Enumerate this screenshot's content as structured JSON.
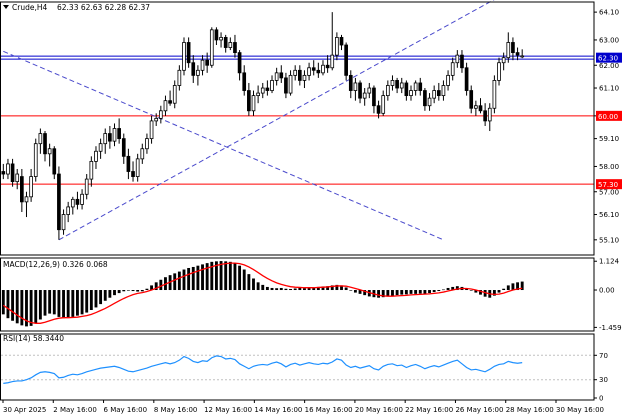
{
  "window": {
    "symbol_title": "Crude,H4",
    "ohlc": "62.33 62.63 62.28 62.37"
  },
  "colors": {
    "bull": "#ffffff",
    "bear": "#000000",
    "level": "#ff0000",
    "blue_level": "#0000cc",
    "trend": "#4a4acc",
    "macd_signal": "#ff0000",
    "rsi": "#1e90ff",
    "grid": "#c0c0c0"
  },
  "chart_data": [
    {
      "type": "candlestick",
      "title": "Crude,H4",
      "ylim": [
        54.5,
        64.5
      ],
      "yticks": [
        "64.10",
        "63.00",
        "62.00",
        "61.10",
        "60.00",
        "59.10",
        "58.00",
        "57.00",
        "56.10",
        "55.10"
      ],
      "xticks": [
        "30 Apr 2025",
        "2 May 16:00",
        "6 May 16:00",
        "8 May 16:00",
        "12 May 16:00",
        "14 May 16:00",
        "16 May 16:00",
        "20 May 16:00",
        "22 May 16:00",
        "26 May 16:00",
        "28 May 16:00",
        "30 May 16:00"
      ],
      "levels": [
        {
          "label": "62.30",
          "value": 62.3,
          "color": "blue"
        },
        {
          "label": "60.00",
          "value": 60.0,
          "color": "red"
        },
        {
          "label": "57.30",
          "value": 57.3,
          "color": "red"
        }
      ],
      "trendlines": [
        {
          "from_x": 0,
          "from_y": 62.55,
          "to_x": 95,
          "to_y": 55.1
        },
        {
          "from_x": 12,
          "from_y": 55.1,
          "to_x": 106,
          "to_y": 64.6
        }
      ],
      "x_count": 128,
      "candles": [
        [
          0,
          57.8,
          58.1,
          57.5,
          57.7
        ],
        [
          1,
          57.7,
          58.3,
          57.5,
          58.1
        ],
        [
          2,
          58.1,
          58.3,
          57.2,
          57.4
        ],
        [
          3,
          57.4,
          57.9,
          57.1,
          57.7
        ],
        [
          4,
          57.6,
          57.9,
          56.2,
          56.6
        ],
        [
          5,
          56.6,
          57.0,
          56.0,
          56.8
        ],
        [
          6,
          56.8,
          57.9,
          56.6,
          57.6
        ],
        [
          7,
          57.6,
          59.1,
          57.4,
          58.9
        ],
        [
          8,
          58.9,
          59.5,
          58.5,
          59.3
        ],
        [
          9,
          59.3,
          59.4,
          58.2,
          58.5
        ],
        [
          10,
          58.5,
          58.9,
          58.0,
          58.7
        ],
        [
          11,
          58.7,
          58.8,
          57.5,
          57.7
        ],
        [
          12,
          57.7,
          58.0,
          55.1,
          55.5
        ],
        [
          13,
          55.5,
          56.3,
          55.3,
          56.1
        ],
        [
          14,
          56.1,
          56.6,
          55.8,
          56.4
        ],
        [
          15,
          56.4,
          56.8,
          56.1,
          56.7
        ],
        [
          16,
          56.7,
          57.0,
          56.3,
          56.5
        ],
        [
          17,
          56.5,
          57.1,
          56.3,
          56.9
        ],
        [
          18,
          56.9,
          57.7,
          56.7,
          57.5
        ],
        [
          19,
          57.5,
          58.4,
          57.2,
          58.2
        ],
        [
          20,
          58.2,
          58.8,
          57.9,
          58.6
        ],
        [
          21,
          58.6,
          59.1,
          58.3,
          58.9
        ],
        [
          22,
          58.9,
          59.5,
          58.5,
          59.3
        ],
        [
          23,
          59.3,
          59.6,
          58.7,
          59.0
        ],
        [
          24,
          59.0,
          59.7,
          58.8,
          59.5
        ],
        [
          25,
          59.5,
          59.9,
          58.9,
          59.1
        ],
        [
          26,
          59.1,
          59.3,
          58.1,
          58.4
        ],
        [
          27,
          58.4,
          58.7,
          57.5,
          57.8
        ],
        [
          28,
          57.8,
          58.2,
          57.4,
          57.6
        ],
        [
          29,
          57.6,
          58.5,
          57.4,
          58.3
        ],
        [
          30,
          58.3,
          58.9,
          58.1,
          58.7
        ],
        [
          31,
          58.7,
          59.3,
          58.5,
          59.1
        ],
        [
          32,
          59.1,
          60.0,
          58.9,
          59.8
        ],
        [
          33,
          59.8,
          60.1,
          59.6,
          59.9
        ],
        [
          34,
          59.9,
          60.4,
          59.7,
          60.2
        ],
        [
          35,
          60.2,
          60.8,
          60.0,
          60.6
        ],
        [
          36,
          60.6,
          61.0,
          60.4,
          60.5
        ],
        [
          37,
          60.5,
          61.4,
          60.3,
          61.2
        ],
        [
          38,
          61.2,
          62.0,
          61.0,
          61.8
        ],
        [
          39,
          61.8,
          63.1,
          61.6,
          62.9
        ],
        [
          40,
          62.9,
          63.1,
          61.9,
          62.1
        ],
        [
          41,
          62.1,
          62.4,
          61.3,
          61.6
        ],
        [
          42,
          61.6,
          62.0,
          61.2,
          61.8
        ],
        [
          43,
          61.8,
          62.4,
          61.6,
          62.2
        ],
        [
          44,
          62.2,
          62.5,
          61.7,
          62.0
        ],
        [
          45,
          62.0,
          63.5,
          61.9,
          63.4
        ],
        [
          46,
          63.4,
          63.5,
          62.8,
          63.0
        ],
        [
          47,
          63.0,
          63.3,
          62.7,
          63.1
        ],
        [
          48,
          63.1,
          63.2,
          62.5,
          62.7
        ],
        [
          49,
          62.7,
          63.1,
          62.6,
          62.9
        ],
        [
          50,
          62.9,
          63.2,
          62.3,
          62.5
        ],
        [
          51,
          62.5,
          62.6,
          61.4,
          61.7
        ],
        [
          52,
          61.7,
          62.0,
          60.8,
          61.0
        ],
        [
          53,
          61.0,
          61.3,
          60.0,
          60.2
        ],
        [
          54,
          60.2,
          61.0,
          60.0,
          60.8
        ],
        [
          55,
          60.8,
          61.2,
          60.5,
          60.9
        ],
        [
          56,
          60.9,
          61.3,
          60.7,
          61.1
        ],
        [
          57,
          61.1,
          61.4,
          60.8,
          61.0
        ],
        [
          58,
          61.0,
          61.6,
          60.9,
          61.4
        ],
        [
          59,
          61.4,
          61.9,
          61.2,
          61.7
        ],
        [
          60,
          61.7,
          62.0,
          61.3,
          61.5
        ],
        [
          61,
          61.5,
          61.7,
          60.7,
          60.9
        ],
        [
          62,
          60.9,
          61.8,
          60.8,
          61.6
        ],
        [
          63,
          61.6,
          62.0,
          61.4,
          61.8
        ],
        [
          64,
          61.8,
          62.0,
          61.2,
          61.4
        ],
        [
          65,
          61.4,
          61.8,
          61.1,
          61.6
        ],
        [
          66,
          61.6,
          62.1,
          61.4,
          61.9
        ],
        [
          67,
          61.9,
          62.2,
          61.6,
          61.8
        ],
        [
          68,
          61.8,
          62.1,
          61.5,
          61.7
        ],
        [
          69,
          61.7,
          62.2,
          61.6,
          62.0
        ],
        [
          70,
          62.0,
          62.4,
          61.7,
          61.9
        ],
        [
          71,
          61.9,
          64.1,
          61.8,
          62.4
        ],
        [
          72,
          62.4,
          63.3,
          62.2,
          63.1
        ],
        [
          73,
          63.1,
          63.2,
          62.6,
          62.8
        ],
        [
          74,
          62.8,
          62.9,
          61.4,
          61.6
        ],
        [
          75,
          61.6,
          61.8,
          60.7,
          61.0
        ],
        [
          76,
          61.0,
          61.5,
          60.6,
          61.3
        ],
        [
          77,
          61.3,
          61.4,
          60.5,
          60.7
        ],
        [
          78,
          60.7,
          61.1,
          60.4,
          60.9
        ],
        [
          79,
          60.9,
          61.3,
          60.7,
          61.1
        ],
        [
          80,
          61.1,
          61.2,
          60.1,
          60.4
        ],
        [
          81,
          60.4,
          60.6,
          59.9,
          60.1
        ],
        [
          82,
          60.1,
          61.0,
          60.0,
          60.8
        ],
        [
          83,
          60.8,
          61.4,
          60.6,
          61.2
        ],
        [
          84,
          61.2,
          61.6,
          61.0,
          61.4
        ],
        [
          85,
          61.4,
          61.5,
          60.9,
          61.1
        ],
        [
          86,
          61.1,
          61.5,
          60.9,
          61.3
        ],
        [
          87,
          61.3,
          61.4,
          60.6,
          60.8
        ],
        [
          88,
          60.8,
          61.2,
          60.6,
          61.0
        ],
        [
          89,
          61.0,
          61.4,
          60.8,
          61.3
        ],
        [
          90,
          61.3,
          61.5,
          60.8,
          61.0
        ],
        [
          91,
          61.0,
          61.1,
          60.2,
          60.4
        ],
        [
          92,
          60.4,
          60.9,
          60.2,
          60.7
        ],
        [
          93,
          60.7,
          61.2,
          60.5,
          61.0
        ],
        [
          94,
          61.0,
          61.3,
          60.6,
          60.8
        ],
        [
          95,
          60.8,
          61.4,
          60.6,
          61.2
        ],
        [
          96,
          61.2,
          61.8,
          61.0,
          61.6
        ],
        [
          97,
          61.6,
          62.3,
          61.4,
          62.1
        ],
        [
          98,
          62.1,
          62.6,
          61.9,
          62.4
        ],
        [
          99,
          62.4,
          62.6,
          61.7,
          61.9
        ],
        [
          100,
          61.9,
          62.1,
          60.8,
          61.0
        ],
        [
          101,
          61.0,
          61.2,
          60.1,
          60.3
        ],
        [
          102,
          60.3,
          60.6,
          60.0,
          60.4
        ],
        [
          103,
          60.4,
          60.7,
          60.1,
          60.2
        ],
        [
          104,
          60.2,
          60.5,
          59.6,
          59.8
        ],
        [
          105,
          59.8,
          60.5,
          59.4,
          60.3
        ],
        [
          106,
          60.3,
          61.6,
          60.1,
          61.4
        ],
        [
          107,
          61.4,
          62.3,
          61.2,
          62.1
        ],
        [
          108,
          62.1,
          62.5,
          61.8,
          62.3
        ],
        [
          109,
          62.3,
          63.3,
          62.1,
          62.9
        ],
        [
          110,
          62.9,
          63.1,
          62.2,
          62.5
        ],
        [
          111,
          62.5,
          62.7,
          62.2,
          62.4
        ],
        [
          112,
          62.33,
          62.63,
          62.28,
          62.37
        ]
      ]
    },
    {
      "type": "macd",
      "title": "MACD(12,26,9) 0.326 0.068",
      "ylim": [
        -1.6,
        1.25
      ],
      "yticks": [
        "1.124",
        "0.00",
        "-1.459"
      ],
      "histogram": [
        -0.95,
        -1.1,
        -1.2,
        -1.3,
        -1.38,
        -1.42,
        -1.4,
        -1.3,
        -1.15,
        -1.0,
        -0.92,
        -0.95,
        -1.05,
        -1.1,
        -1.08,
        -1.05,
        -1.0,
        -0.95,
        -0.88,
        -0.78,
        -0.68,
        -0.55,
        -0.42,
        -0.3,
        -0.2,
        -0.12,
        -0.05,
        0.0,
        -0.04,
        -0.06,
        -0.05,
        0.05,
        0.18,
        0.3,
        0.4,
        0.5,
        0.58,
        0.65,
        0.72,
        0.8,
        0.86,
        0.9,
        0.95,
        1.0,
        1.05,
        1.1,
        1.12,
        1.13,
        1.12,
        1.1,
        1.05,
        0.95,
        0.8,
        0.62,
        0.45,
        0.3,
        0.2,
        0.12,
        0.08,
        0.07,
        0.08,
        0.05,
        0.04,
        0.06,
        0.08,
        0.07,
        0.08,
        0.1,
        0.12,
        0.14,
        0.15,
        0.18,
        0.2,
        0.18,
        0.1,
        -0.02,
        -0.1,
        -0.15,
        -0.2,
        -0.25,
        -0.28,
        -0.3,
        -0.28,
        -0.25,
        -0.22,
        -0.2,
        -0.18,
        -0.17,
        -0.15,
        -0.15,
        -0.14,
        -0.15,
        -0.12,
        -0.08,
        -0.04,
        0.02,
        0.08,
        0.12,
        0.15,
        0.12,
        0.05,
        -0.02,
        -0.1,
        -0.18,
        -0.26,
        -0.3,
        -0.22,
        -0.1,
        0.05,
        0.18,
        0.26,
        0.3,
        0.33
      ],
      "signal": [
        -0.6,
        -0.72,
        -0.85,
        -0.98,
        -1.1,
        -1.2,
        -1.27,
        -1.3,
        -1.3,
        -1.26,
        -1.2,
        -1.14,
        -1.1,
        -1.08,
        -1.08,
        -1.07,
        -1.06,
        -1.03,
        -1.0,
        -0.95,
        -0.88,
        -0.8,
        -0.72,
        -0.62,
        -0.52,
        -0.42,
        -0.33,
        -0.25,
        -0.18,
        -0.13,
        -0.1,
        -0.06,
        0.0,
        0.07,
        0.15,
        0.23,
        0.31,
        0.39,
        0.47,
        0.54,
        0.61,
        0.68,
        0.74,
        0.8,
        0.86,
        0.91,
        0.96,
        1.0,
        1.03,
        1.05,
        1.05,
        1.03,
        0.98,
        0.9,
        0.8,
        0.68,
        0.56,
        0.45,
        0.36,
        0.28,
        0.22,
        0.17,
        0.13,
        0.11,
        0.1,
        0.09,
        0.09,
        0.09,
        0.1,
        0.11,
        0.12,
        0.14,
        0.16,
        0.16,
        0.15,
        0.11,
        0.06,
        0.01,
        -0.05,
        -0.1,
        -0.15,
        -0.2,
        -0.23,
        -0.24,
        -0.24,
        -0.23,
        -0.22,
        -0.21,
        -0.19,
        -0.18,
        -0.17,
        -0.16,
        -0.15,
        -0.13,
        -0.11,
        -0.08,
        -0.04,
        0.0,
        0.04,
        0.06,
        0.06,
        0.04,
        0.0,
        -0.05,
        -0.1,
        -0.15,
        -0.17,
        -0.16,
        -0.12,
        -0.06,
        0.0,
        0.04,
        0.07
      ]
    },
    {
      "type": "line",
      "title": "RSI(14) 58.3440",
      "ylim": [
        0,
        100
      ],
      "yticks": [
        "70",
        "30",
        "0"
      ],
      "levels": [
        70,
        30
      ],
      "values": [
        24,
        25,
        27,
        28,
        28,
        30,
        33,
        38,
        42,
        43,
        42,
        40,
        33,
        34,
        37,
        39,
        38,
        40,
        43,
        45,
        47,
        49,
        50,
        51,
        52,
        50,
        47,
        44,
        43,
        45,
        47,
        49,
        52,
        54,
        56,
        58,
        56,
        58,
        62,
        68,
        65,
        60,
        58,
        61,
        60,
        66,
        69,
        68,
        64,
        65,
        63,
        56,
        52,
        48,
        52,
        54,
        55,
        54,
        57,
        59,
        56,
        51,
        55,
        57,
        54,
        56,
        58,
        56,
        55,
        57,
        56,
        59,
        64,
        62,
        54,
        50,
        52,
        49,
        51,
        53,
        48,
        46,
        52,
        55,
        56,
        53,
        54,
        50,
        53,
        55,
        52,
        48,
        51,
        53,
        51,
        54,
        57,
        60,
        62,
        56,
        50,
        46,
        47,
        45,
        43,
        47,
        52,
        55,
        56,
        60,
        58,
        57,
        58
      ]
    }
  ]
}
